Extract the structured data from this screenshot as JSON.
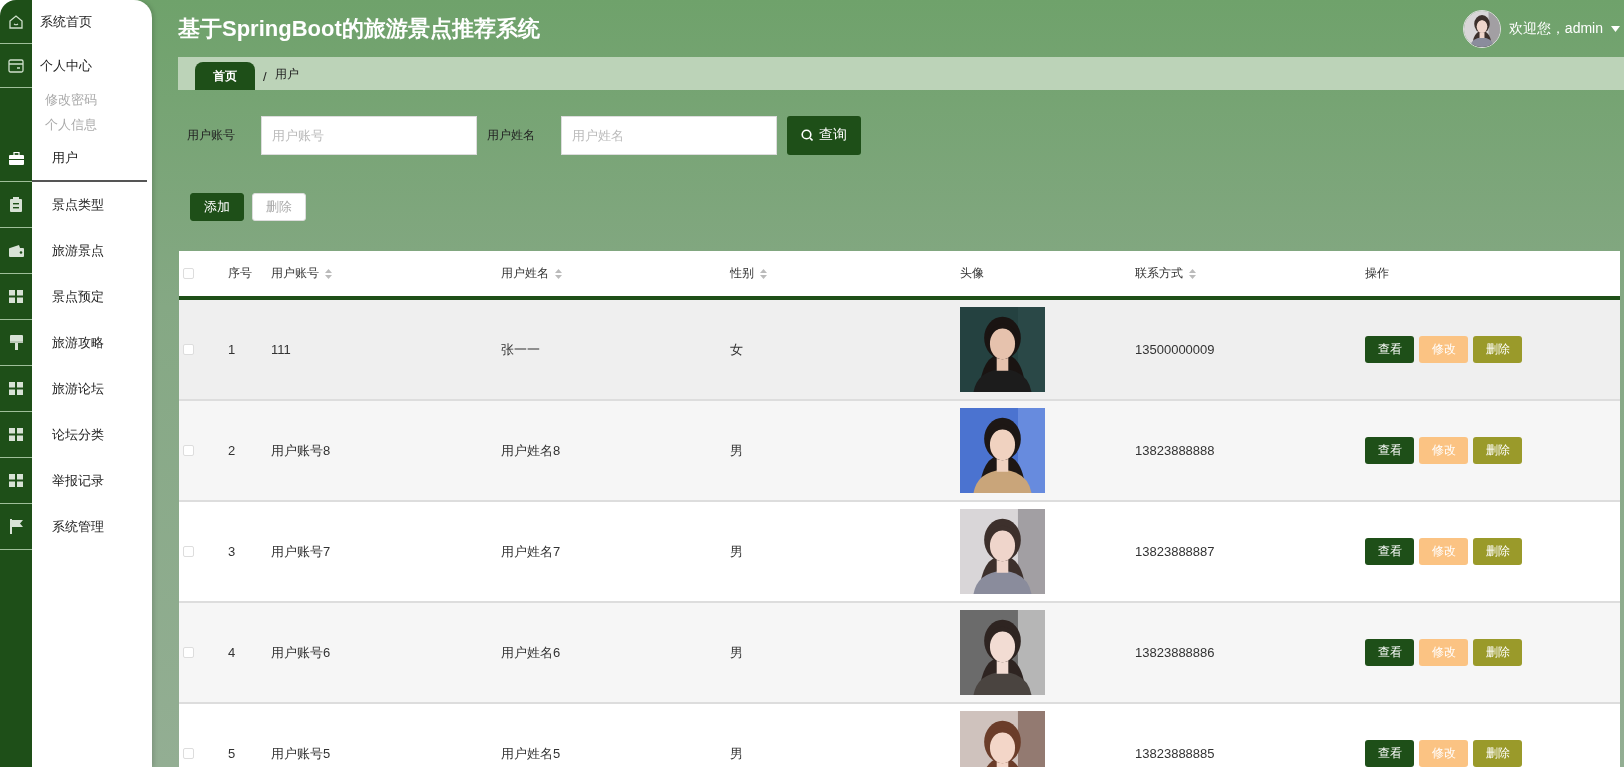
{
  "sidebar": {
    "items": [
      {
        "label": "系统首页",
        "selected": false
      },
      {
        "label": "个人中心",
        "selected": false,
        "children": [
          {
            "label": "修改密码",
            "selected": false
          },
          {
            "label": "个人信息",
            "selected": false
          }
        ]
      },
      {
        "label": "用户",
        "selected": true
      },
      {
        "label": "景点类型",
        "selected": false
      },
      {
        "label": "旅游景点",
        "selected": false
      },
      {
        "label": "景点预定",
        "selected": false
      },
      {
        "label": "旅游攻略",
        "selected": false
      },
      {
        "label": "旅游论坛",
        "selected": false
      },
      {
        "label": "论坛分类",
        "selected": false
      },
      {
        "label": "举报记录",
        "selected": false
      },
      {
        "label": "系统管理",
        "selected": false
      }
    ]
  },
  "header": {
    "title": "基于SpringBoot的旅游景点推荐系统",
    "user": "欢迎您，admin"
  },
  "breadcrumb": {
    "separator": "/",
    "items": [
      "首页",
      "用户"
    ]
  },
  "search": {
    "fields": [
      {
        "label": "用户账号",
        "placeholder": "用户账号"
      },
      {
        "label": "用户姓名",
        "placeholder": "用户姓名"
      }
    ],
    "button": "查询"
  },
  "actions": [
    {
      "label": "添加",
      "disabled": false
    },
    {
      "label": "删除",
      "disabled": true
    }
  ],
  "table": {
    "header_checked": false,
    "columns": [
      {
        "label": "序号",
        "sortable": false
      },
      {
        "label": "用户账号",
        "sortable": true
      },
      {
        "label": "用户姓名",
        "sortable": true
      },
      {
        "label": "性别",
        "sortable": true
      },
      {
        "label": "头像",
        "sortable": false
      },
      {
        "label": "联系方式",
        "sortable": true
      },
      {
        "label": "操作",
        "sortable": false
      }
    ],
    "rows": [
      {
        "checked": false,
        "cells": [
          "1",
          "111",
          "张一一",
          "女"
        ],
        "avatar": {
          "kind": "picture"
        },
        "phone": "13500000009",
        "buttons": [
          {
            "label": "查看",
            "kind": "view"
          },
          {
            "label": "修改",
            "kind": "edit"
          },
          {
            "label": "删除",
            "kind": "delete"
          }
        ]
      },
      {
        "checked": false,
        "cells": [
          "2",
          "用户账号8",
          "用户姓名8",
          "男"
        ],
        "avatar": {
          "kind": "picture"
        },
        "phone": "13823888888",
        "buttons": [
          {
            "label": "查看",
            "kind": "view"
          },
          {
            "label": "修改",
            "kind": "edit"
          },
          {
            "label": "删除",
            "kind": "delete"
          }
        ]
      },
      {
        "checked": false,
        "cells": [
          "3",
          "用户账号7",
          "用户姓名7",
          "男"
        ],
        "avatar": {
          "kind": "picture"
        },
        "phone": "13823888887",
        "buttons": [
          {
            "label": "查看",
            "kind": "view"
          },
          {
            "label": "修改",
            "kind": "edit"
          },
          {
            "label": "删除",
            "kind": "delete"
          }
        ]
      },
      {
        "checked": false,
        "cells": [
          "4",
          "用户账号6",
          "用户姓名6",
          "男"
        ],
        "avatar": {
          "kind": "picture"
        },
        "phone": "13823888886",
        "buttons": [
          {
            "label": "查看",
            "kind": "view"
          },
          {
            "label": "修改",
            "kind": "edit"
          },
          {
            "label": "删除",
            "kind": "delete"
          }
        ]
      },
      {
        "checked": false,
        "cells": [
          "5",
          "用户账号5",
          "用户姓名5",
          "男"
        ],
        "avatar": {
          "kind": "picture"
        },
        "phone": "13823888885",
        "buttons": [
          {
            "label": "查看",
            "kind": "view"
          },
          {
            "label": "修改",
            "kind": "edit"
          },
          {
            "label": "删除",
            "kind": "delete"
          }
        ]
      }
    ]
  }
}
